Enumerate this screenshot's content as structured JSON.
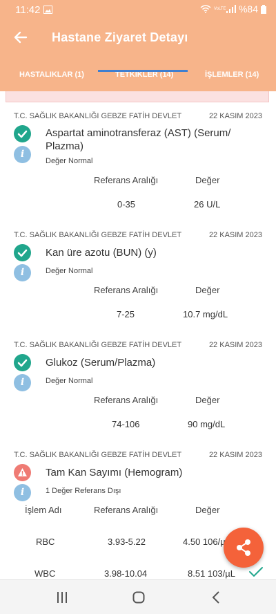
{
  "status_bar": {
    "time": "11:42",
    "battery": "%84",
    "network": "VoLTE"
  },
  "app_bar": {
    "title": "Hastane Ziyaret Detayı",
    "back_icon": "arrow-back-icon"
  },
  "tabs": [
    {
      "label": "HASTALIKLAR (1)",
      "selected": false
    },
    {
      "label": "TETKİKLER (14)",
      "selected": true
    },
    {
      "label": "İŞLEMLER (14)",
      "selected": false
    }
  ],
  "labels": {
    "ref_header": "Referans Aralığı",
    "value_header": "Değer",
    "name_header": "İşlem Adı"
  },
  "tests": [
    {
      "institution": "T.C. SAĞLIK BAKANLIĞI GEBZE FATİH DEVLET",
      "date": "22 KASIM 2023",
      "name": "Aspartat aminotransferaz (AST) (Serum/ Plazma)",
      "note": "Değer Normal",
      "status": "normal",
      "ref": "0-35",
      "value": "26 U/L"
    },
    {
      "institution": "T.C. SAĞLIK BAKANLIĞI GEBZE FATİH DEVLET",
      "date": "22 KASIM 2023",
      "name": "Kan üre azotu (BUN)   (y)",
      "note": "Değer Normal",
      "status": "normal",
      "ref": "7-25",
      "value": "10.7 mg/dL"
    },
    {
      "institution": "T.C. SAĞLIK BAKANLIĞI GEBZE FATİH DEVLET",
      "date": "22 KASIM 2023",
      "name": "Glukoz (Serum/Plazma)",
      "note": "Değer Normal",
      "status": "normal",
      "ref": "74-106",
      "value": "90 mg/dL"
    },
    {
      "institution": "T.C. SAĞLIK BAKANLIĞI GEBZE FATİH DEVLET",
      "date": "22 KASIM 2023",
      "name": "Tam Kan Sayımı (Hemogram)",
      "note": "1 Değer Referans Dışı",
      "status": "warning",
      "rows": [
        {
          "name": "RBC",
          "ref": "3.93-5.22",
          "value": "4.50 106/µL"
        },
        {
          "name": "WBC",
          "ref": "3.98-10.04",
          "value": "8.51 103/µL"
        }
      ]
    }
  ],
  "colors": {
    "header": "#f7b48a",
    "ok": "#20a68c",
    "warn": "#ef7b74",
    "info": "#8fbfe2",
    "fab": "#f4623a",
    "tab_indicator": "#3f7fd0"
  },
  "fab": {
    "icon": "share-icon"
  }
}
